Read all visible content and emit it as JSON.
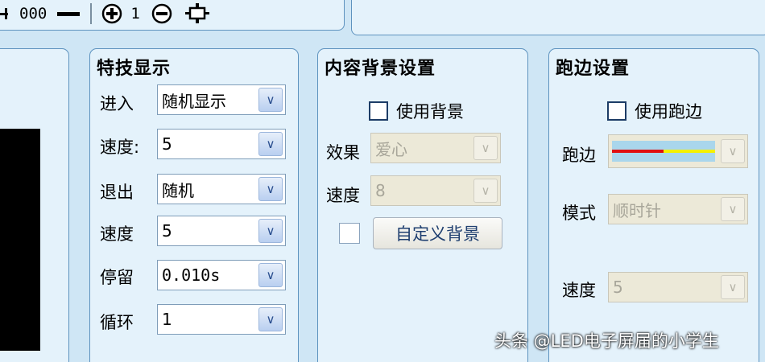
{
  "toolbar": {
    "digits": "000",
    "zoom_value": "1"
  },
  "effects": {
    "title": "特技显示",
    "enter_label": "进入",
    "enter_value": "随机显示",
    "speed1_label": "速度:",
    "speed1_value": "5",
    "exit_label": "退出",
    "exit_value": "随机",
    "speed2_label": "速度",
    "speed2_value": "5",
    "stay_label": "停留",
    "stay_value": "0.010s",
    "loop_label": "循环",
    "loop_value": "1"
  },
  "background": {
    "title": "内容背景设置",
    "use_label": "使用背景",
    "effect_label": "效果",
    "effect_value": "爱心",
    "speed_label": "速度",
    "speed_value": "8",
    "custom_button": "自定义背景"
  },
  "border": {
    "title": "跑边设置",
    "use_label": "使用跑边",
    "border_label": "跑边",
    "mode_label": "模式",
    "mode_value": "顺时针",
    "speed_label": "速度",
    "speed_value": "5",
    "colors": {
      "red": "#e01010",
      "yellow": "#f4f000",
      "track": "#a9d6ec"
    }
  },
  "watermark": "头条 @LED电子屏届的小学生"
}
